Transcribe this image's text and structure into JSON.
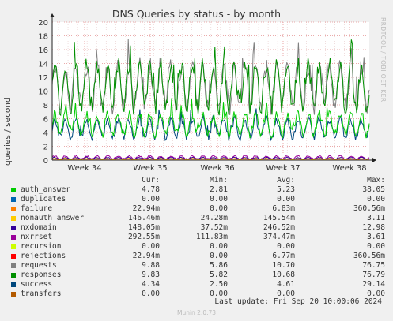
{
  "chart_data": {
    "type": "line",
    "title": "DNS Queries by status - by month",
    "ylabel": "queries / second",
    "ylim": [
      0,
      20
    ],
    "yticks": [
      0,
      2,
      4,
      6,
      8,
      10,
      12,
      14,
      16,
      18,
      20
    ],
    "xticks": [
      "Week 34",
      "Week 35",
      "Week 36",
      "Week 37",
      "Week 38"
    ],
    "legend_headers": [
      "Cur:",
      "Min:",
      "Avg:",
      "Max:"
    ],
    "series": [
      {
        "name": "auth_answer",
        "color": "#00cc00",
        "cur": "4.78",
        "min": "2.81",
        "avg": "5.23",
        "max": "38.05"
      },
      {
        "name": "duplicates",
        "color": "#0066b3",
        "cur": "0.00",
        "min": "0.00",
        "avg": "0.00",
        "max": "0.00"
      },
      {
        "name": "failure",
        "color": "#ff8000",
        "cur": "22.94m",
        "min": "0.00",
        "avg": "6.83m",
        "max": "360.56m"
      },
      {
        "name": "nonauth_answer",
        "color": "#ffcc00",
        "cur": "146.46m",
        "min": "24.28m",
        "avg": "145.54m",
        "max": "3.11"
      },
      {
        "name": "nxdomain",
        "color": "#330099",
        "cur": "148.05m",
        "min": "37.52m",
        "avg": "246.52m",
        "max": "12.98"
      },
      {
        "name": "nxrrset",
        "color": "#990099",
        "cur": "292.55m",
        "min": "111.83m",
        "avg": "374.47m",
        "max": "3.61"
      },
      {
        "name": "recursion",
        "color": "#ccff00",
        "cur": "0.00",
        "min": "0.00",
        "avg": "0.00",
        "max": "0.00"
      },
      {
        "name": "rejections",
        "color": "#ff0000",
        "cur": "22.94m",
        "min": "0.00",
        "avg": "6.77m",
        "max": "360.56m"
      },
      {
        "name": "requests",
        "color": "#808080",
        "cur": "9.88",
        "min": "5.86",
        "avg": "10.70",
        "max": "76.75"
      },
      {
        "name": "responses",
        "color": "#008f00",
        "cur": "9.83",
        "min": "5.82",
        "avg": "10.68",
        "max": "76.79"
      },
      {
        "name": "success",
        "color": "#00487d",
        "cur": "4.34",
        "min": "2.50",
        "avg": "4.61",
        "max": "29.14"
      },
      {
        "name": "transfers",
        "color": "#b35a00",
        "cur": "0.00",
        "min": "0.00",
        "avg": "0.00",
        "max": "0.00"
      }
    ]
  },
  "watermark": "RRDTOOL / TOBI OETIKER",
  "last_update": "Last update:  Fri Sep 20 10:00:06 2024",
  "munin_version": "Munin 2.0.73"
}
